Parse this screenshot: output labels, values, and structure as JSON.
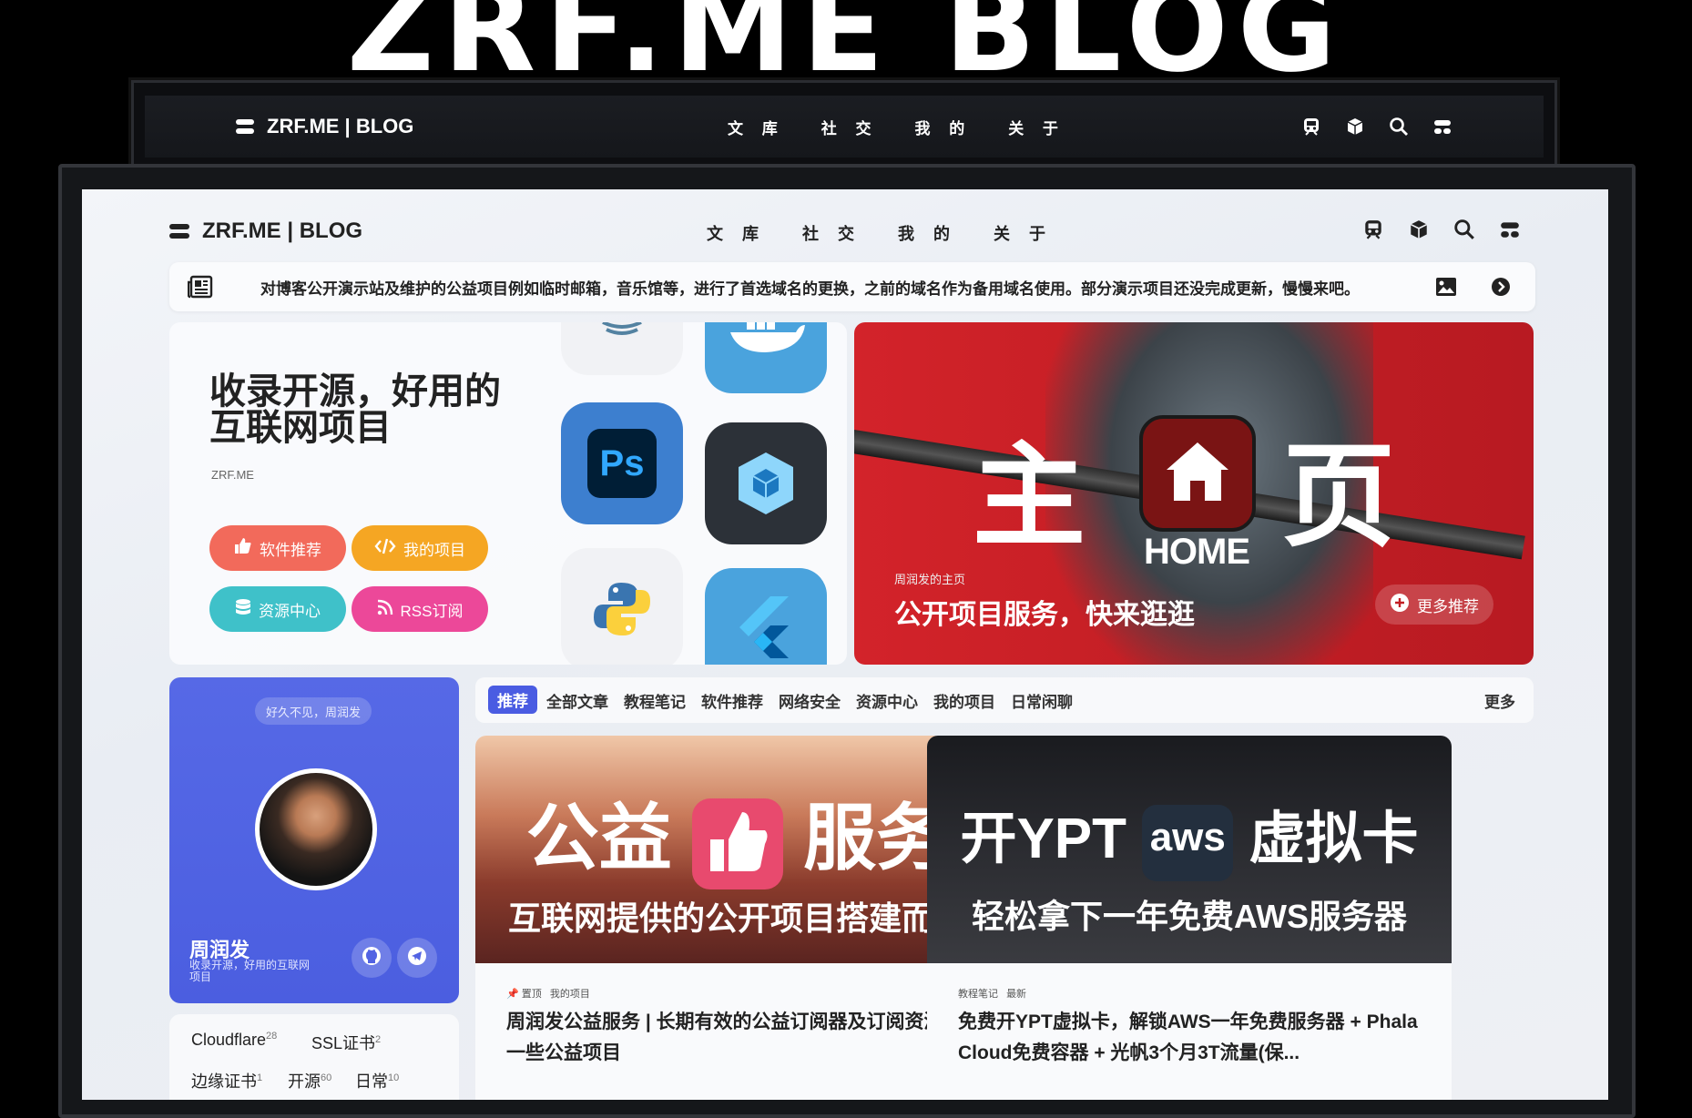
{
  "banner": {
    "title": "ZRF.ME BLOG"
  },
  "site": {
    "name": "ZRF.ME | BLOG"
  },
  "nav": {
    "items": [
      "文 库",
      "社 交",
      "我 的",
      "关 于"
    ]
  },
  "icons": [
    "train-icon",
    "cube-icon",
    "search-icon",
    "menu-toggle-icon"
  ],
  "notice": {
    "text": "对博客公开演示站及维护的公益项目例如临时邮箱，音乐馆等，进行了首选域名的更换，之前的域名作为备用域名使用。部分演示项目还没完成更新，慢慢来吧。"
  },
  "hero": {
    "title_line1": "收录开源，好用的",
    "title_line2": "互联网项目",
    "subtitle": "ZRF.ME",
    "buttons": [
      "软件推荐",
      "我的项目",
      "资源中心",
      "RSS订阅"
    ],
    "tiles": [
      "java-icon",
      "docker-icon",
      "photoshop-icon",
      "webpack-icon",
      "python-icon",
      "flutter-icon"
    ],
    "ps_label": "Ps"
  },
  "feature": {
    "big_left": "主",
    "big_right": "页",
    "home_word": "HOME",
    "caption_small": "周润发的主页",
    "caption": "公开项目服务，快来逛逛",
    "more": "更多推荐"
  },
  "profile": {
    "greeting": "好久不见，周润发",
    "name": "周润发",
    "bio": "收录开源，好用的互联网项目"
  },
  "tags": [
    {
      "name": "Cloudflare",
      "count": "28"
    },
    {
      "name": "SSL证书",
      "count": "2"
    },
    {
      "name": "边缘证书",
      "count": "1"
    },
    {
      "name": "开源",
      "count": "60"
    },
    {
      "name": "日常",
      "count": "10"
    }
  ],
  "tabs": {
    "items": [
      "推荐",
      "全部文章",
      "教程笔记",
      "软件推荐",
      "网络安全",
      "资源中心",
      "我的项目",
      "日常闲聊"
    ],
    "more": "更多"
  },
  "cards": [
    {
      "img_big_left": "公益",
      "img_big_right": "服务",
      "img_sub": "互联网提供的公开项目搭建而成",
      "tag1": "置顶",
      "tag2": "我的项目",
      "title": "周润发公益服务 | 长期有效的公益订阅器及订阅资源与一些公益项目"
    },
    {
      "img_big_left": "开YPT",
      "img_big_right": "虚拟卡",
      "aws": "aws",
      "img_sub": "轻松拿下一年免费AWS服务器",
      "tag1": "教程笔记",
      "tag2": "最新",
      "title": "免费开YPT虚拟卡，解锁AWS一年免费服务器 + Phala Cloud免费容器 + 光帆3个月3T流量(保..."
    }
  ],
  "colors": {
    "accent": "#4a5ce2",
    "pill_software": "#f26a5b",
    "pill_project": "#f5a623",
    "pill_resource": "#3fc1c9",
    "pill_rss": "#ec4899",
    "hero_red": "#d3232a"
  }
}
